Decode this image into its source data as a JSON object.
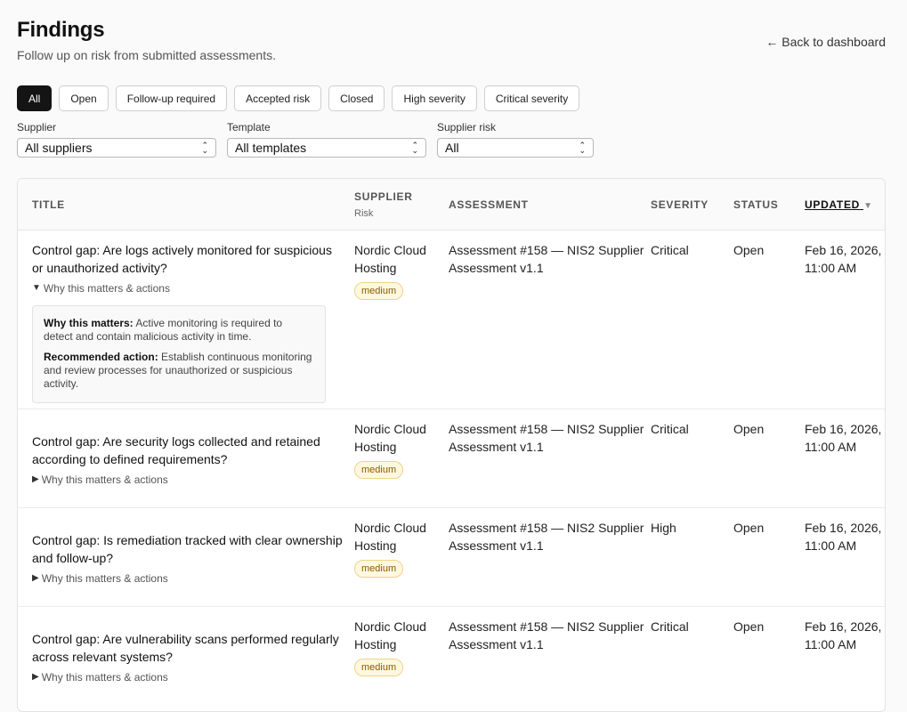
{
  "header": {
    "title": "Findings",
    "subtitle": "Follow up on risk from submitted assessments.",
    "back_link": "← Back to dashboard"
  },
  "chips": [
    {
      "label": "All",
      "active": true
    },
    {
      "label": "Open"
    },
    {
      "label": "Follow-up required"
    },
    {
      "label": "Accepted risk"
    },
    {
      "label": "Closed"
    },
    {
      "label": "High severity"
    },
    {
      "label": "Critical severity"
    }
  ],
  "filters": {
    "supplier": {
      "label": "Supplier",
      "value": "All suppliers"
    },
    "template": {
      "label": "Template",
      "value": "All templates"
    },
    "risk": {
      "label": "Supplier risk",
      "value": "All"
    }
  },
  "table": {
    "headers": {
      "title": "TITLE",
      "supplier": "SUPPLIER",
      "supplier_sub": "Risk",
      "assessment": "ASSESSMENT",
      "severity": "SEVERITY",
      "status": "STATUS",
      "updated": "UPDATED",
      "sort_icon": "▼"
    },
    "rows": [
      {
        "title": "Control gap: Are logs actively monitored for suspicious or unauthorized activity?",
        "toggle": "Why this matters & actions",
        "expanded": true,
        "why_label": "Why this matters:",
        "why_text": "Active monitoring is required to detect and contain malicious activity in time.",
        "action_label": "Recommended action:",
        "action_text": "Establish continuous monitoring and review processes for unauthorized or suspicious activity.",
        "supplier": "Nordic Cloud Hosting",
        "risk": "medium",
        "assessment": "Assessment #158 — NIS2 Supplier Assessment v1.1",
        "severity": "Critical",
        "status": "Open",
        "updated": "Feb 16, 2026, 11:00 AM"
      },
      {
        "title": "Control gap: Are security logs collected and retained according to defined requirements?",
        "toggle": "Why this matters & actions",
        "expanded": false,
        "supplier": "Nordic Cloud Hosting",
        "risk": "medium",
        "assessment": "Assessment #158 — NIS2 Supplier Assessment v1.1",
        "severity": "Critical",
        "status": "Open",
        "updated": "Feb 16, 2026, 11:00 AM"
      },
      {
        "title": "Control gap: Is remediation tracked with clear ownership and follow-up?",
        "toggle": "Why this matters & actions",
        "expanded": false,
        "supplier": "Nordic Cloud Hosting",
        "risk": "medium",
        "assessment": "Assessment #158 — NIS2 Supplier Assessment v1.1",
        "severity": "High",
        "status": "Open",
        "updated": "Feb 16, 2026, 11:00 AM"
      },
      {
        "title": "Control gap: Are vulnerability scans performed regularly across relevant systems?",
        "toggle": "Why this matters & actions",
        "expanded": false,
        "supplier": "Nordic Cloud Hosting",
        "risk": "medium",
        "assessment": "Assessment #158 — NIS2 Supplier Assessment v1.1",
        "severity": "Critical",
        "status": "Open",
        "updated": "Feb 16, 2026, 11:00 AM"
      }
    ]
  }
}
